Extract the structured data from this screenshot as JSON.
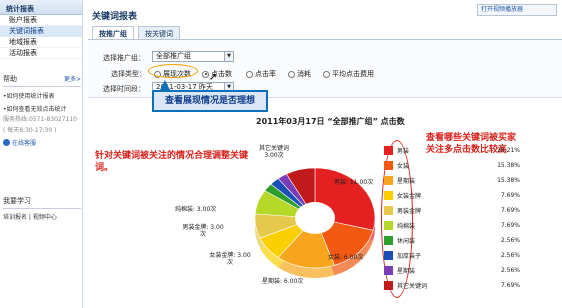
{
  "sidebar": {
    "header": "统计报表",
    "items": [
      "账户报表",
      "关键词报表",
      "地域报表",
      "活动报表"
    ],
    "help": {
      "title": "帮助",
      "more": "更多>",
      "links": [
        "•如何使用统计报表",
        "•如何查看无效点击统计"
      ],
      "service_line1": "服务热线:0571-83027110",
      "service_line2": "( 每天8:30-17:30 )",
      "online": "在线客服"
    },
    "learn": {
      "title": "我要学习",
      "links": "培训报名 | 视频中心"
    }
  },
  "main": {
    "title": "关键词报表",
    "top_link": "打开视频播放器",
    "tabs": [
      "按推广组",
      "按关键词"
    ],
    "filter": {
      "group_label": "选择推广组：",
      "group_value": "全部推广组",
      "type_label": "选择类型：",
      "radios": [
        "展现次数",
        "点击数",
        "点击率",
        "消耗",
        "平均点击费用"
      ],
      "checked_index": 1,
      "time_label": "选择时间段：",
      "time_value": "2011-03-17 昨天"
    },
    "callout": "查看展现情况是否理想",
    "annotation_left": "针对关键词被关注的情况合理调整关键词。",
    "annotation_right": "查看哪些关键词被买家关注多点击数比较高"
  },
  "chart_data": {
    "type": "pie",
    "title": "2011年03月17日 “全部推广组” 点击数",
    "unit": "次",
    "slices": [
      {
        "name": "男装",
        "value": 11,
        "pct": "28.21%",
        "color": "#e42020"
      },
      {
        "name": "女装",
        "value": 6,
        "pct": "15.38%",
        "color": "#f25a14"
      },
      {
        "name": "星期装",
        "value": 6,
        "pct": "15.38%",
        "color": "#f7a51c"
      },
      {
        "name": "女装金牌",
        "value": 3,
        "pct": "7.69%",
        "color": "#fad000"
      },
      {
        "name": "男装金牌",
        "value": 3,
        "pct": "7.69%",
        "color": "#e6c84b"
      },
      {
        "name": "纯棉装",
        "value": 3,
        "pct": "7.69%",
        "color": "#b6d829"
      },
      {
        "name": "休闲装",
        "value": 1,
        "pct": "2.56%",
        "color": "#2e9e2c"
      },
      {
        "name": "加厚装子",
        "value": 1,
        "pct": "2.56%",
        "color": "#1a4fb8"
      },
      {
        "name": "星期装",
        "value": 1,
        "pct": "2.56%",
        "color": "#7a3cb8"
      },
      {
        "name": "其它关键词",
        "value": 3,
        "pct": "7.69%",
        "color": "#c01a1a"
      }
    ],
    "labels": [
      {
        "text": "男装: 11.00次"
      },
      {
        "text": "女装: 6.00次"
      },
      {
        "text": "星期装: 6.00次"
      },
      {
        "text": "女装金牌: 3.00次"
      },
      {
        "text": "男装金牌: 3.00次"
      },
      {
        "text": "纯棉装: 3.00次"
      },
      {
        "text": "其它关键词 3.00次"
      }
    ]
  }
}
